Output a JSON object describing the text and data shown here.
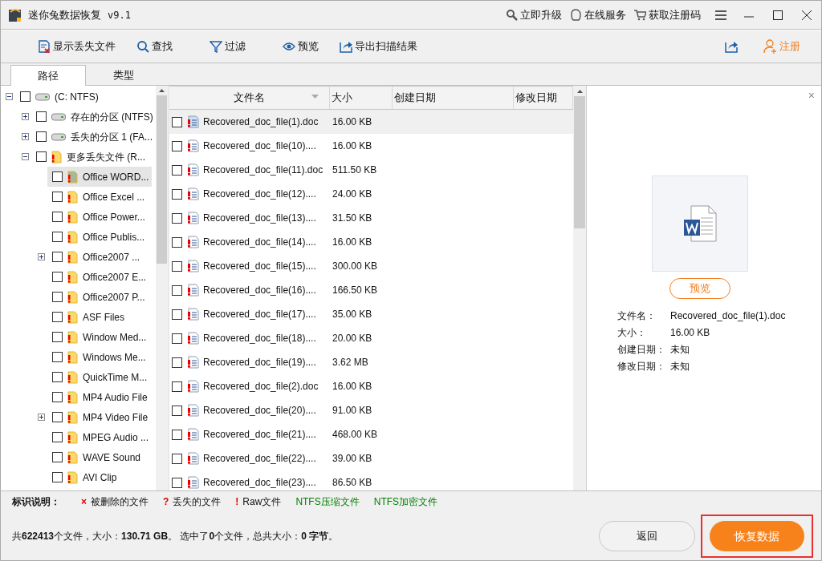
{
  "window": {
    "title": "迷你兔数据恢复",
    "version": "v9.1",
    "links": [
      "立即升级",
      "在线服务",
      "获取注册码"
    ]
  },
  "toolbar": {
    "items": [
      "显示丢失文件",
      "查找",
      "过滤",
      "预览",
      "导出扫描结果"
    ],
    "register": "注册"
  },
  "tabs": [
    {
      "label": "路径",
      "selected": true
    },
    {
      "label": "类型",
      "selected": false
    }
  ],
  "tree": [
    {
      "label": "(C: NTFS)",
      "kind": "drive",
      "checked": false,
      "selected": false,
      "expanded": true,
      "children": [
        {
          "label": "存在的分区 (NTFS)",
          "kind": "drive",
          "checked": false,
          "selected": false,
          "expanded": false
        },
        {
          "label": "丢失的分区 1 (FA...",
          "kind": "drive",
          "checked": false,
          "selected": false,
          "expanded": false
        },
        {
          "label": "更多丢失文件 (R...",
          "kind": "folder",
          "checked": false,
          "selected": false,
          "expanded": true,
          "children": [
            {
              "label": "Office WORD...",
              "kind": "folder",
              "checked": false,
              "selected": true
            },
            {
              "label": "Office Excel ...",
              "kind": "folder",
              "checked": false,
              "selected": false
            },
            {
              "label": "Office Power...",
              "kind": "folder",
              "checked": false,
              "selected": false
            },
            {
              "label": "Office Publis...",
              "kind": "folder",
              "checked": false,
              "selected": false
            },
            {
              "label": "Office2007 ...",
              "kind": "folder",
              "checked": false,
              "selected": false,
              "expanded": false
            },
            {
              "label": "Office2007 E...",
              "kind": "folder",
              "checked": false,
              "selected": false
            },
            {
              "label": "Office2007 P...",
              "kind": "folder",
              "checked": false,
              "selected": false
            },
            {
              "label": "ASF Files",
              "kind": "folder",
              "checked": false,
              "selected": false
            },
            {
              "label": "Window Med...",
              "kind": "folder",
              "checked": false,
              "selected": false
            },
            {
              "label": "Windows Me...",
              "kind": "folder",
              "checked": false,
              "selected": false
            },
            {
              "label": "QuickTime M...",
              "kind": "folder",
              "checked": false,
              "selected": false
            },
            {
              "label": "MP4 Audio File",
              "kind": "folder",
              "checked": false,
              "selected": false
            },
            {
              "label": "MP4 Video File",
              "kind": "folder",
              "checked": false,
              "selected": false,
              "expanded": false
            },
            {
              "label": "MPEG Audio ...",
              "kind": "folder",
              "checked": false,
              "selected": false
            },
            {
              "label": "WAVE Sound",
              "kind": "folder",
              "checked": false,
              "selected": false
            },
            {
              "label": "AVI Clip",
              "kind": "folder",
              "checked": false,
              "selected": false
            }
          ]
        }
      ]
    }
  ],
  "table": {
    "columns": [
      "文件名",
      "大小",
      "创建日期",
      "修改日期"
    ],
    "rows": [
      {
        "name": "Recovered_doc_file(1).doc",
        "size": "16.00 KB",
        "checked": false,
        "selected": true
      },
      {
        "name": "Recovered_doc_file(10)....",
        "size": "16.00 KB",
        "checked": false,
        "selected": false
      },
      {
        "name": "Recovered_doc_file(11).doc",
        "size": "511.50 KB",
        "checked": false,
        "selected": false
      },
      {
        "name": "Recovered_doc_file(12)....",
        "size": "24.00 KB",
        "checked": false,
        "selected": false
      },
      {
        "name": "Recovered_doc_file(13)....",
        "size": "31.50 KB",
        "checked": false,
        "selected": false
      },
      {
        "name": "Recovered_doc_file(14)....",
        "size": "16.00 KB",
        "checked": false,
        "selected": false
      },
      {
        "name": "Recovered_doc_file(15)....",
        "size": "300.00 KB",
        "checked": false,
        "selected": false
      },
      {
        "name": "Recovered_doc_file(16)....",
        "size": "166.50 KB",
        "checked": false,
        "selected": false
      },
      {
        "name": "Recovered_doc_file(17)....",
        "size": "35.00 KB",
        "checked": false,
        "selected": false
      },
      {
        "name": "Recovered_doc_file(18)....",
        "size": "20.00 KB",
        "checked": false,
        "selected": false
      },
      {
        "name": "Recovered_doc_file(19)....",
        "size": "3.62 MB",
        "checked": false,
        "selected": false
      },
      {
        "name": "Recovered_doc_file(2).doc",
        "size": "16.00 KB",
        "checked": false,
        "selected": false
      },
      {
        "name": "Recovered_doc_file(20)....",
        "size": "91.00 KB",
        "checked": false,
        "selected": false
      },
      {
        "name": "Recovered_doc_file(21)....",
        "size": "468.00 KB",
        "checked": false,
        "selected": false
      },
      {
        "name": "Recovered_doc_file(22)....",
        "size": "39.00 KB",
        "checked": false,
        "selected": false
      },
      {
        "name": "Recovered_doc_file(23)....",
        "size": "86.50 KB",
        "checked": false,
        "selected": false
      }
    ]
  },
  "preview": {
    "close": "×",
    "button": "预览",
    "details": [
      {
        "label": "文件名：",
        "value": "Recovered_doc_file(1).doc"
      },
      {
        "label": "大小：",
        "value": "16.00 KB"
      },
      {
        "label": "创建日期：",
        "value": "未知"
      },
      {
        "label": "修改日期：",
        "value": "未知"
      }
    ]
  },
  "legend": {
    "title": "标识说明：",
    "items": [
      {
        "mark": "×",
        "label": "被删除的文件",
        "color": "#e00000"
      },
      {
        "mark": "?",
        "label": "丢失的文件",
        "color": "#e00000"
      },
      {
        "mark": "!",
        "label": "Raw文件",
        "color": "#e00000"
      },
      {
        "label": "NTFS压缩文件",
        "color": "#008000"
      },
      {
        "label": "NTFS加密文件",
        "color": "#008000"
      }
    ]
  },
  "status": "共**622413**个文件，大小：**130.71 GB**。 选中了**0**个文件，总共大小：**0 字节**。",
  "buttons": {
    "back": "返回",
    "recover": "恢复数据"
  }
}
